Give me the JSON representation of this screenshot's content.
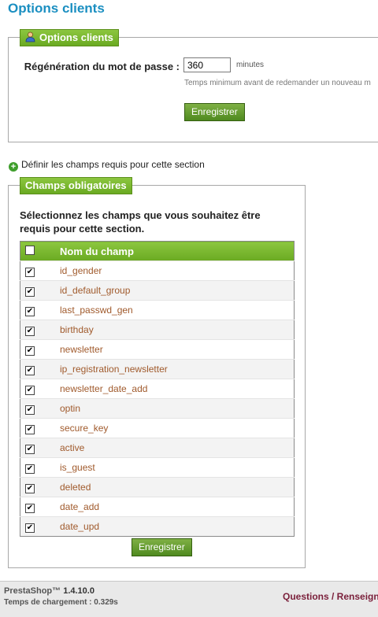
{
  "page": {
    "title": "Options clients"
  },
  "options": {
    "legend": "Options clients",
    "regen_label": "Régénération du mot de passe :",
    "regen_value": "360",
    "regen_unit": "minutes",
    "hint": "Temps minimum avant de redemander un nouveau m",
    "save_label": "Enregistrer"
  },
  "define_link": {
    "label": "Définir les champs requis pour cette section"
  },
  "required": {
    "legend": "Champs obligatoires",
    "instructions": "Sélectionnez les champs que vous souhaitez être requis pour cette section.",
    "column_header": "Nom du champ",
    "fields": [
      {
        "name": "id_gender",
        "checked": true
      },
      {
        "name": "id_default_group",
        "checked": true
      },
      {
        "name": "last_passwd_gen",
        "checked": true
      },
      {
        "name": "birthday",
        "checked": true
      },
      {
        "name": "newsletter",
        "checked": true
      },
      {
        "name": "ip_registration_newsletter",
        "checked": true
      },
      {
        "name": "newsletter_date_add",
        "checked": true
      },
      {
        "name": "optin",
        "checked": true
      },
      {
        "name": "secure_key",
        "checked": true
      },
      {
        "name": "active",
        "checked": true
      },
      {
        "name": "is_guest",
        "checked": true
      },
      {
        "name": "deleted",
        "checked": true
      },
      {
        "name": "date_add",
        "checked": true
      },
      {
        "name": "date_upd",
        "checked": true
      }
    ],
    "save_label": "Enregistrer"
  },
  "footer": {
    "brand": "PrestaShop™",
    "version": "1.4.10.0",
    "load_time": "Temps de chargement : 0.329s",
    "links": "Questions / Renseigne"
  },
  "colors": {
    "accent_green": "#7ab53a",
    "title_blue": "#1b8fc1",
    "field_link": "#a05a2c"
  }
}
